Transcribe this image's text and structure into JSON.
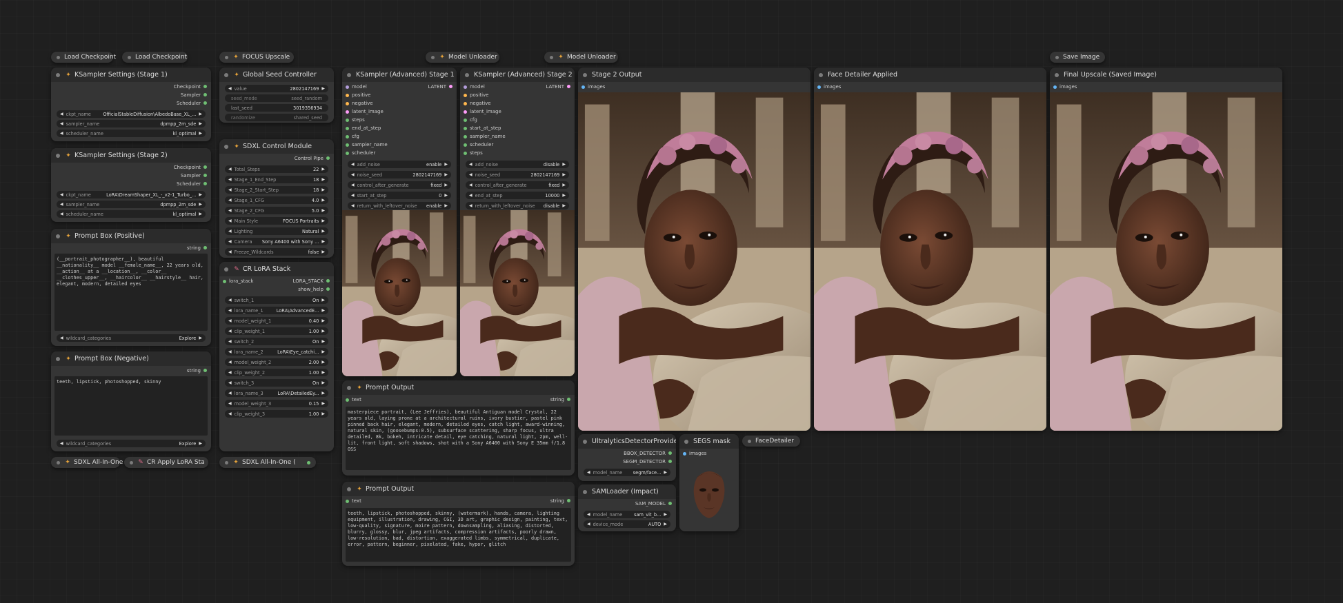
{
  "colors": {
    "canvas": "#1f1f1f",
    "node": "#353535",
    "title": "#2b2b2b",
    "widget": "#222222",
    "accent": "#e8a43a"
  },
  "collapsed": {
    "load_checkpoint_1": "Load Checkpoint",
    "load_checkpoint_2": "Load Checkpoint",
    "focus_upscale": "FOCUS Upscale",
    "model_unloader_1": "Model Unloader",
    "model_unloader_2": "Model Unloader",
    "save_image": "Save Image",
    "sdxl_aio_1": "SDXL All-In-One",
    "cr_apply_lora": "CR Apply LoRA Sta",
    "sdxl_aio_2": "SDXL All-In-One (",
    "face_detailer": "FaceDetailer"
  },
  "ks1": {
    "title": "KSampler Settings (Stage 1)",
    "outputs": [
      "Checkpoint",
      "Sampler",
      "Scheduler"
    ],
    "widgets": [
      {
        "label": "ckpt_name",
        "value": "OfficialStableDiffusion\\AlbedoBase_XL_..."
      },
      {
        "label": "sampler_name",
        "value": "dpmpp_2m_sde"
      },
      {
        "label": "scheduler_name",
        "value": "kl_optimal"
      }
    ]
  },
  "ks2": {
    "title": "KSampler Settings (Stage 2)",
    "outputs": [
      "Checkpoint",
      "Sampler",
      "Scheduler"
    ],
    "widgets": [
      {
        "label": "ckpt_name",
        "value": "LoRA\\DreamShaper_XL_-_v2-1_Turbo_..."
      },
      {
        "label": "sampler_name",
        "value": "dpmpp_2m_sde"
      },
      {
        "label": "scheduler_name",
        "value": "kl_optimal"
      }
    ]
  },
  "pos": {
    "title": "Prompt Box (Positive)",
    "output": "string",
    "text": "(__portrait_photographer__), beautiful __nationality__ model __female_name__, 22 years old, __action__ at a __location__, __color__ __clothes_upper__, __haircolor__ __hairstyle__ hair, elegant, modern, detailed eyes",
    "wildcard": {
      "label": "wildcard_categories",
      "value": "Explore"
    }
  },
  "neg": {
    "title": "Prompt Box (Negative)",
    "output": "string",
    "text": "teeth, lipstick, photoshopped, skinny",
    "wildcard": {
      "label": "wildcard_categories",
      "value": "Explore"
    }
  },
  "seed": {
    "title": "Global Seed Controller",
    "widgets": [
      {
        "label": "value",
        "value": "2802147169",
        "dis": false
      },
      {
        "label": "seed_mode",
        "value": "seed_random",
        "dis": true
      },
      {
        "label": "last_seed",
        "value": "3019356934",
        "dis": false
      },
      {
        "label": "randomize",
        "value": "shared_seed",
        "dis": true
      }
    ]
  },
  "sdxl": {
    "title": "SDXL Control Module",
    "output": "Control Pipe",
    "widgets": [
      {
        "label": "Total_Steps",
        "value": "22"
      },
      {
        "label": "Stage_1_End_Step",
        "value": "18"
      },
      {
        "label": "Stage_2_Start_Step",
        "value": "18"
      },
      {
        "label": "Stage_1_CFG",
        "value": "4.0"
      },
      {
        "label": "Stage_2_CFG",
        "value": "5.0"
      },
      {
        "label": "Main Style",
        "value": "FOCUS Portraits"
      },
      {
        "label": "Lighting",
        "value": "Natural"
      },
      {
        "label": "Camera",
        "value": "Sony A6400 with Sony ..."
      },
      {
        "label": "Freeze_Wildcards",
        "value": "false"
      }
    ]
  },
  "lora": {
    "title": "CR LoRA Stack",
    "input": "lora_stack",
    "outputs": [
      "LORA_STACK",
      "show_help"
    ],
    "widgets": [
      {
        "label": "switch_1",
        "value": "On"
      },
      {
        "label": "lora_name_1",
        "value": "LoRA\\AdvancedE..."
      },
      {
        "label": "model_weight_1",
        "value": "0.40"
      },
      {
        "label": "clip_weight_1",
        "value": "1.00"
      },
      {
        "label": "switch_2",
        "value": "On"
      },
      {
        "label": "lora_name_2",
        "value": "LoRA\\Eye_catchi..."
      },
      {
        "label": "model_weight_2",
        "value": "2.00"
      },
      {
        "label": "clip_weight_2",
        "value": "1.00"
      },
      {
        "label": "switch_3",
        "value": "On"
      },
      {
        "label": "lora_name_3",
        "value": "LoRA\\DetailedEy..."
      },
      {
        "label": "model_weight_3",
        "value": "0.15"
      },
      {
        "label": "clip_weight_3",
        "value": "1.00"
      }
    ]
  },
  "ksa1": {
    "title": "KSampler (Advanced) Stage 1",
    "output": "LATENT",
    "inputs": [
      "model",
      "positive",
      "negative",
      "latent_image",
      "steps",
      "end_at_step",
      "cfg",
      "sampler_name",
      "scheduler"
    ],
    "widgets": [
      {
        "label": "add_noise",
        "value": "enable"
      },
      {
        "label": "noise_seed",
        "value": "2802147169"
      },
      {
        "label": "control_after_generate",
        "value": "fixed"
      },
      {
        "label": "start_at_step",
        "value": "0"
      },
      {
        "label": "return_with_leftover_noise",
        "value": "enable"
      }
    ]
  },
  "ksa2": {
    "title": "KSampler (Advanced) Stage 2",
    "output": "LATENT",
    "inputs": [
      "model",
      "positive",
      "negative",
      "latent_image",
      "cfg",
      "start_at_step",
      "sampler_name",
      "scheduler",
      "steps"
    ],
    "widgets": [
      {
        "label": "add_noise",
        "value": "disable"
      },
      {
        "label": "noise_seed",
        "value": "2802147169"
      },
      {
        "label": "control_after_generate",
        "value": "fixed"
      },
      {
        "label": "end_at_step",
        "value": "10000"
      },
      {
        "label": "return_with_leftover_noise",
        "value": "disable"
      }
    ]
  },
  "po1": {
    "title": "Prompt Output",
    "input": "text",
    "output": "string",
    "text": "masterpiece portrait, (Lee Jeffries), beautiful Antiguan model Crystal, 22 years old, laying prone at a architectural ruins, ivory bustier, pastel pink pinned back hair, elegant, modern, detailed eyes, catch light, award-winning, natural skin, (goosebumps:0.5), subsurface scattering, sharp focus, ultra detailed, 8k, bokeh, intricate detail, eye catching, natural light, 2pm, well-lit, front light, soft shadows, shot with a Sony A6400 with Sony E 35mm f/1.8 OSS"
  },
  "po2": {
    "title": "Prompt Output",
    "input": "text",
    "output": "string",
    "text": "teeth, lipstick, photoshopped, skinny, (watermark), hands, camera, lighting equipment, illustration, drawing, CGI, 3D art, graphic design, painting, text, low-quality, signature, moire pattern, downsampling, aliasing, distorted, blurry, glossy, blur, jpeg artifacts, compression artifacts, poorly drawn, low-resolution, bad, distortion, exaggerated limbs, symmetrical, duplicate, error, pattern, beginner, pixelated, fake, hypor, glitch"
  },
  "stage2": {
    "title": "Stage 2 Output",
    "input": "images"
  },
  "face": {
    "title": "Face Detailer Applied",
    "input": "images"
  },
  "final": {
    "title": "Final Upscale (Saved Image)",
    "input": "images"
  },
  "ultra": {
    "title": "UltralyticsDetectorProvider",
    "outputs": [
      "BBOX_DETECTOR",
      "SEGM_DETECTOR"
    ],
    "widget": {
      "label": "model_name",
      "value": "segm/face..."
    }
  },
  "sam": {
    "title": "SAMLoader (Impact)",
    "output": "SAM_MODEL",
    "widgets": [
      {
        "label": "model_name",
        "value": "sam_vit_b..."
      },
      {
        "label": "device_mode",
        "value": "AUTO"
      }
    ]
  },
  "segs": {
    "title": "SEGS mask",
    "input": "images"
  }
}
